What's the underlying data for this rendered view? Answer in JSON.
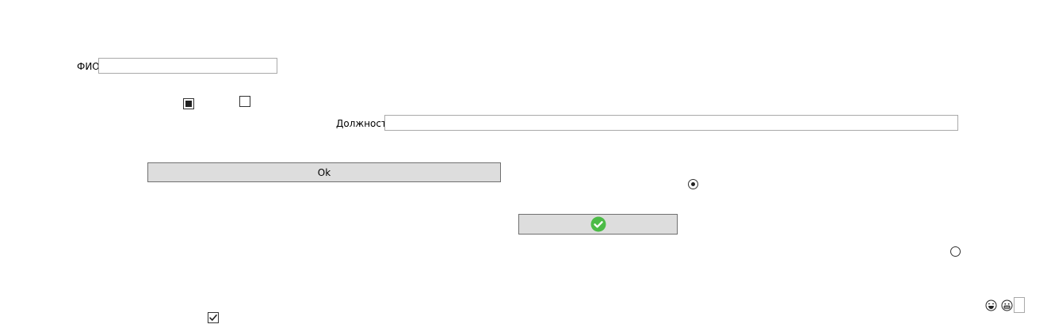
{
  "form": {
    "fio_label": "ФИО",
    "fio_value": "",
    "position_label": "Должность",
    "position_value": "",
    "ok_button_label": "Ok",
    "small_field_value": ""
  },
  "controls": {
    "checkbox_indeterminate": {
      "state": "indeterminate"
    },
    "checkbox_empty": {
      "checked": false
    },
    "checkbox_bottom": {
      "checked": true
    },
    "radio_1": {
      "selected": true
    },
    "radio_2": {
      "selected": false
    }
  },
  "icons": {
    "confirm_button_icon": "check-circle-icon",
    "confirm_icon_color": "#4cbb47",
    "emoji_1": "laughing-face-icon",
    "emoji_2": "grinning-face-icon"
  }
}
